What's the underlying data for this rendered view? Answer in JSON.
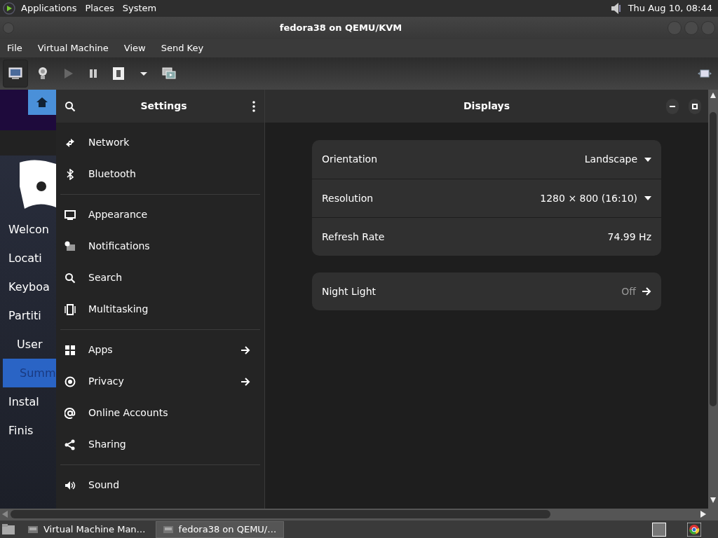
{
  "top_panel": {
    "menus": [
      "Applications",
      "Places",
      "System"
    ],
    "clock": "Thu Aug 10, 08:44"
  },
  "window": {
    "title": "fedora38 on QEMU/KVM"
  },
  "menubar": [
    "File",
    "Virtual Machine",
    "View",
    "Send Key"
  ],
  "toolbar": [
    {
      "kind": "console",
      "selected": true
    },
    {
      "kind": "details",
      "selected": false
    },
    {
      "kind": "run",
      "selected": false
    },
    {
      "kind": "pause",
      "selected": false
    },
    {
      "kind": "power",
      "selected": false
    },
    {
      "kind": "dropdown",
      "selected": false
    },
    {
      "kind": "snapshots",
      "selected": false
    }
  ],
  "installer": {
    "steps": [
      {
        "label": "Welcon",
        "selected": false,
        "kind": "step"
      },
      {
        "label": "Locati",
        "selected": false,
        "kind": "step"
      },
      {
        "label": "Keyboa",
        "selected": false,
        "kind": "step"
      },
      {
        "label": "Partiti",
        "selected": false,
        "kind": "step"
      },
      {
        "label": "User",
        "selected": false,
        "kind": "substep"
      },
      {
        "label": "Summ",
        "selected": true,
        "kind": "substep"
      },
      {
        "label": "Instal",
        "selected": false,
        "kind": "step"
      },
      {
        "label": "Finis",
        "selected": false,
        "kind": "step"
      }
    ]
  },
  "settings": {
    "title": "Settings",
    "groups": [
      [
        {
          "label": "Network",
          "arrow": false
        },
        {
          "label": "Bluetooth",
          "arrow": false
        }
      ],
      [
        {
          "label": "Appearance",
          "arrow": false
        },
        {
          "label": "Notifications",
          "arrow": false
        },
        {
          "label": "Search",
          "arrow": false
        },
        {
          "label": "Multitasking",
          "arrow": false
        }
      ],
      [
        {
          "label": "Apps",
          "arrow": true
        },
        {
          "label": "Privacy",
          "arrow": true
        },
        {
          "label": "Online Accounts",
          "arrow": false
        },
        {
          "label": "Sharing",
          "arrow": false
        }
      ],
      [
        {
          "label": "Sound",
          "arrow": false
        }
      ]
    ]
  },
  "displays": {
    "title": "Displays",
    "rows": [
      {
        "label": "Orientation",
        "value": "Landscape",
        "kind": "dropdown"
      },
      {
        "label": "Resolution",
        "value": "1280 × 800 (16:10)",
        "kind": "dropdown"
      },
      {
        "label": "Refresh Rate",
        "value": "74.99 Hz",
        "kind": "text"
      }
    ],
    "night_light": {
      "label": "Night Light",
      "value": "Off"
    }
  },
  "taskbar": [
    {
      "label": "Virtual Machine Man…",
      "selected": false
    },
    {
      "label": "fedora38 on QEMU/…",
      "selected": true
    }
  ]
}
